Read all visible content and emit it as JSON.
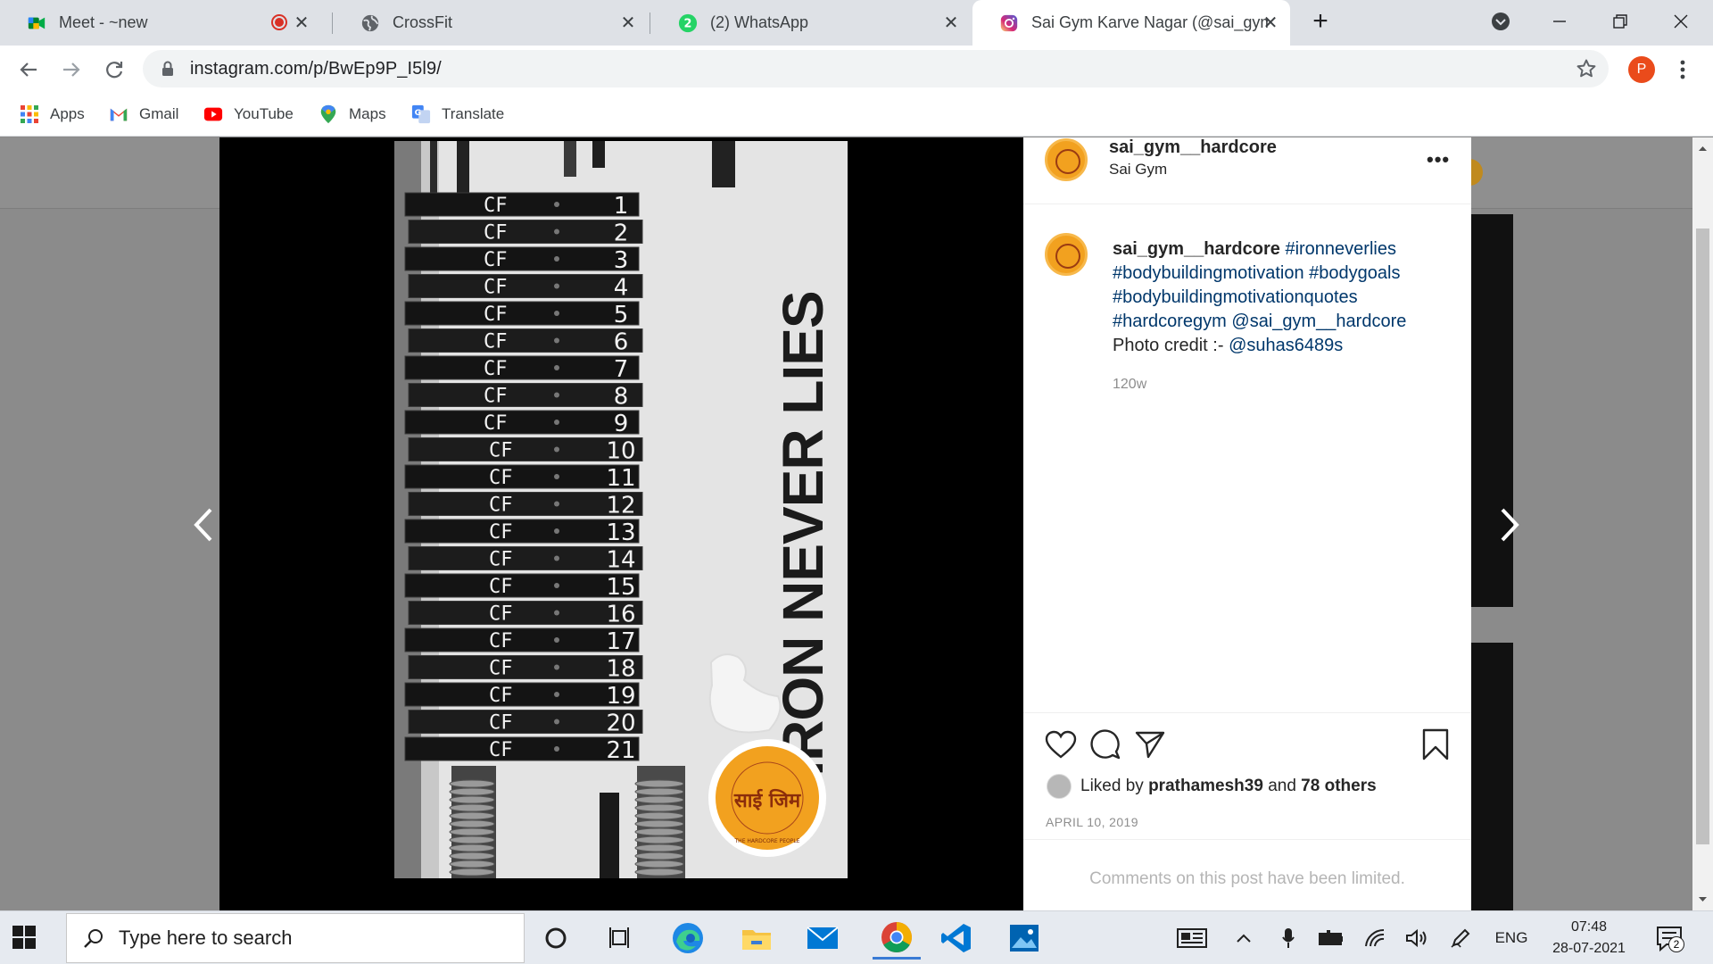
{
  "browser": {
    "tabs": [
      {
        "title": "Meet - ~new",
        "icon": "google-meet-icon"
      },
      {
        "title": "CrossFit",
        "icon": "globe-icon"
      },
      {
        "title": "(2) WhatsApp",
        "icon": "whatsapp-icon"
      },
      {
        "title": "Sai Gym Karve Nagar (@sai_gym...",
        "icon": "instagram-icon",
        "active": true
      }
    ],
    "new_tab": "+",
    "url": "instagram.com/p/BwEp9P_I5l9/",
    "profile_initial": "P",
    "bookmarks": [
      {
        "label": "Apps",
        "icon": "apps-grid-icon"
      },
      {
        "label": "Gmail",
        "icon": "gmail-icon"
      },
      {
        "label": "YouTube",
        "icon": "youtube-icon"
      },
      {
        "label": "Maps",
        "icon": "maps-pin-icon"
      },
      {
        "label": "Translate",
        "icon": "translate-icon"
      }
    ]
  },
  "post": {
    "author": "sai_gym__hardcore",
    "author_subtitle": "Sai Gym",
    "more": "•••",
    "caption_user": "sai_gym__hardcore",
    "caption_parts": [
      {
        "text": "#ironneverlies",
        "tag": true
      },
      {
        "text": "#bodybuildingmotivation",
        "tag": true
      },
      {
        "text": "#bodygoals",
        "tag": true
      },
      {
        "text": "#bodybuildingmotivationquotes",
        "tag": true
      },
      {
        "text": "#hardcoregym",
        "tag": true
      },
      {
        "text": "@sai_gym__hardcore",
        "tag": true
      },
      {
        "text": "Photo credit :-",
        "tag": false
      },
      {
        "text": "@suhas6489s",
        "tag": true
      }
    ],
    "time_ago": "120w",
    "liked_by_prefix": "Liked by",
    "liked_by_user": "prathamesh39",
    "liked_by_and": "and",
    "liked_by_others": "78 others",
    "date": "APRIL 10, 2019",
    "comments_note": "Comments on this post have been limited."
  },
  "photo": {
    "headline": "IRON NEVER LIES",
    "plate_label": "CF",
    "plate_numbers": [
      "1",
      "2",
      "3",
      "4",
      "5",
      "6",
      "7",
      "8",
      "9",
      "10",
      "11",
      "12",
      "13",
      "14",
      "15",
      "16",
      "17",
      "18",
      "19",
      "20",
      "21"
    ],
    "logo_text": "साई जिम",
    "logo_ring_text": "THE HARDCORE PEOPLE"
  },
  "taskbar": {
    "search_placeholder": "Type here to search",
    "language": "ENG",
    "time": "07:48",
    "date": "28-07-2021",
    "notification_count": "2"
  },
  "colors": {
    "tag_blue": "#00376b",
    "logo_orange": "#f2a11f",
    "chrome_bg": "#dee1e6"
  }
}
